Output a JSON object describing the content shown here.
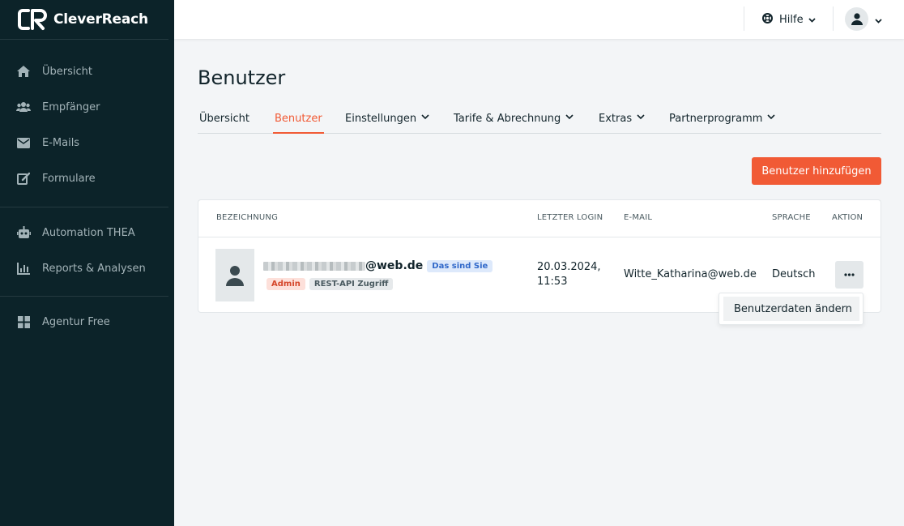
{
  "brand": {
    "name": "CleverReach",
    "accent": "#f15a35",
    "sidebar_bg": "#0c2329"
  },
  "sidebar": {
    "items": [
      {
        "label": "Übersicht",
        "icon": "home-icon"
      },
      {
        "label": "Empfänger",
        "icon": "users-icon"
      },
      {
        "label": "E-Mails",
        "icon": "envelope-icon"
      },
      {
        "label": "Formulare",
        "icon": "edit-form-icon"
      },
      {
        "label": "Automation THEA",
        "icon": "robot-icon"
      },
      {
        "label": "Reports & Analysen",
        "icon": "bar-chart-icon"
      },
      {
        "label": "Agentur Free",
        "icon": "grid-icon"
      }
    ]
  },
  "topbar": {
    "help_label": "Hilfe"
  },
  "page": {
    "title": "Benutzer"
  },
  "tabs": [
    {
      "label": "Übersicht",
      "active": false
    },
    {
      "label": "Benutzer",
      "active": true
    },
    {
      "label": "Einstellungen",
      "active": false
    },
    {
      "label": "Tarife & Abrechnung",
      "active": false
    },
    {
      "label": "Extras",
      "active": false
    },
    {
      "label": "Partnerprogramm",
      "active": false
    }
  ],
  "add_button": "Benutzer hinzufügen",
  "table": {
    "headers": [
      "BEZEICHNUNG",
      "LETZTER LOGIN",
      "E-MAIL",
      "SPRACHE",
      "AKTION"
    ],
    "row": {
      "name_suffix": "@web.de",
      "badge_you": "Das sind Sie",
      "badge_admin": "Admin",
      "badge_api": "REST-API Zugriff",
      "last_login_date": "20.03.2024,",
      "last_login_time": "11:53",
      "email": "Witte_Katharina@web.de",
      "language": "Deutsch"
    }
  },
  "action_menu": {
    "item": "Benutzerdaten ändern"
  }
}
